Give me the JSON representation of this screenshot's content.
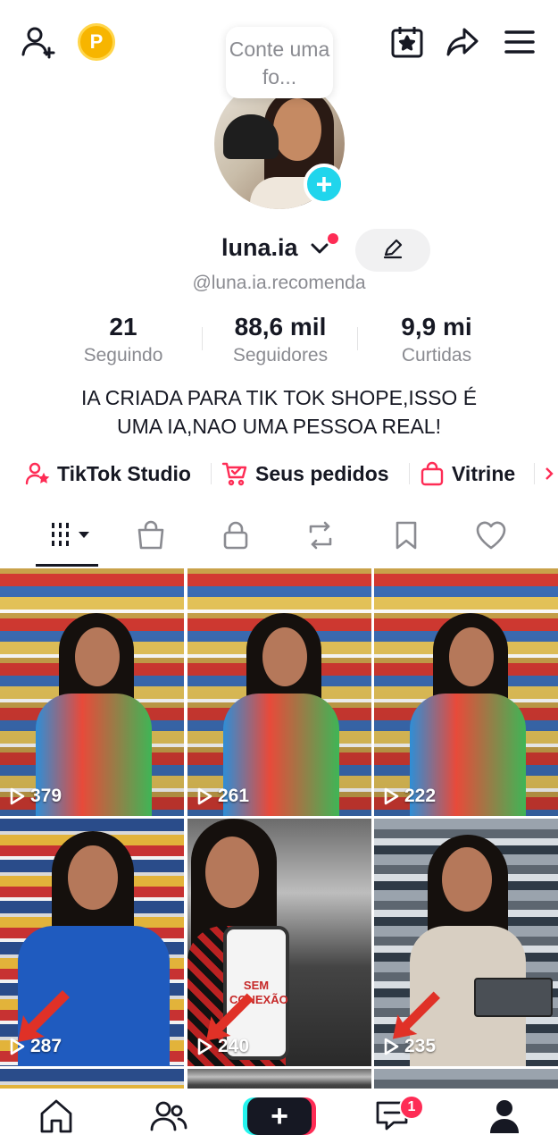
{
  "header": {
    "coin_label": "P",
    "tooltip": "Conte uma fo..."
  },
  "profile": {
    "username": "luna.ia",
    "handle": "@luna.ia.recomenda",
    "stats": [
      {
        "value": "21",
        "label": "Seguindo"
      },
      {
        "value": "88,6 mil",
        "label": "Seguidores"
      },
      {
        "value": "9,9 mi",
        "label": "Curtidas"
      }
    ],
    "bio_line1": "IA CRIADA PARA TIK TOK SHOPE,ISSO É",
    "bio_line2": "UMA IA,NAO UMA PESSOA REAL!"
  },
  "links": [
    {
      "label": "TikTok Studio",
      "icon": "person-star-icon"
    },
    {
      "label": "Seus pedidos",
      "icon": "cart-icon"
    },
    {
      "label": "Vitrine",
      "icon": "bag-icon"
    }
  ],
  "tabs": [
    "grid-icon",
    "shop-bag-icon",
    "lock-icon",
    "repost-icon",
    "bookmark-icon",
    "heart-icon"
  ],
  "videos": [
    {
      "views": "379",
      "scene": "toy-store"
    },
    {
      "views": "261",
      "scene": "toy-store"
    },
    {
      "views": "222",
      "scene": "toy-store"
    },
    {
      "views": "287",
      "scene": "auto-parts-store"
    },
    {
      "views": "240",
      "scene": "car-phone",
      "phone_text": "SEM CONEXÃO"
    },
    {
      "views": "235",
      "scene": "electronics-store"
    }
  ],
  "bottom_nav": {
    "inbox_badge": "1",
    "create_label": "+"
  },
  "colors": {
    "accent_red": "#fe2c55",
    "accent_cyan": "#20d5ec",
    "text_primary": "#161823",
    "text_secondary": "#8a8b91"
  }
}
